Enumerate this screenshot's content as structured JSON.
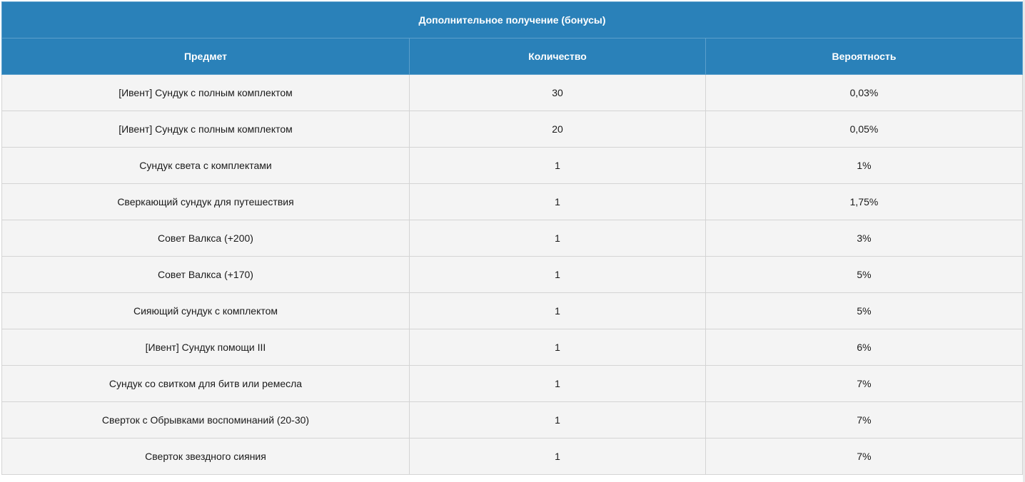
{
  "table": {
    "title": "Дополнительное получение (бонусы)",
    "columns": [
      "Предмет",
      "Количество",
      "Вероятность"
    ],
    "rows": [
      {
        "item": "[Ивент] Сундук с полным комплектом",
        "qty": "30",
        "prob": "0,03%"
      },
      {
        "item": "[Ивент] Сундук с полным комплектом",
        "qty": "20",
        "prob": "0,05%"
      },
      {
        "item": "Сундук света с комплектами",
        "qty": "1",
        "prob": "1%"
      },
      {
        "item": "Сверкающий сундук для путешествия",
        "qty": "1",
        "prob": "1,75%"
      },
      {
        "item": "Совет Валкса (+200)",
        "qty": "1",
        "prob": "3%"
      },
      {
        "item": "Совет Валкса (+170)",
        "qty": "1",
        "prob": "5%"
      },
      {
        "item": "Сияющий сундук с комплектом",
        "qty": "1",
        "prob": "5%"
      },
      {
        "item": "[Ивент] Сундук помощи III",
        "qty": "1",
        "prob": "6%"
      },
      {
        "item": "Сундук со свитком для битв или ремесла",
        "qty": "1",
        "prob": "7%"
      },
      {
        "item": "Сверток с Обрывками воспоминаний (20-30)",
        "qty": "1",
        "prob": "7%"
      },
      {
        "item": "Сверток звездного сияния",
        "qty": "1",
        "prob": "7%"
      }
    ]
  },
  "colors": {
    "header_bg": "#2a81b9",
    "row_bg": "#f4f4f4",
    "border": "#d4d4d4"
  }
}
